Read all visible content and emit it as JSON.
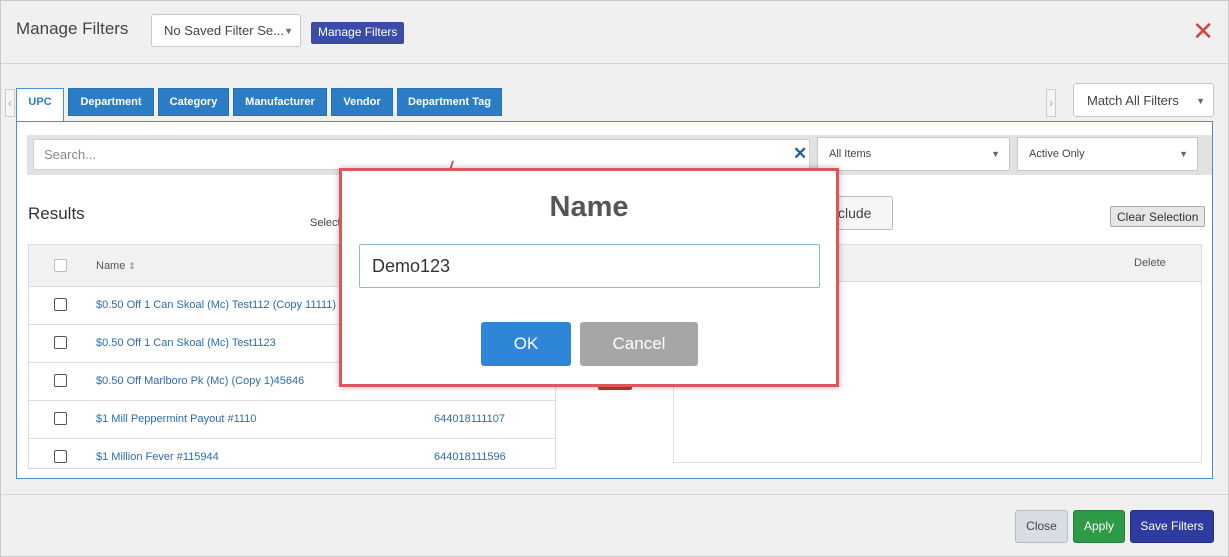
{
  "header": {
    "title": "Manage Filters",
    "saved_filter": "No Saved Filter Se...",
    "manage_button": "Manage Filters"
  },
  "tabs": [
    "UPC",
    "Department",
    "Category",
    "Manufacturer",
    "Vendor",
    "Department Tag"
  ],
  "match_select": "Match All Filters",
  "search": {
    "placeholder": "Search...",
    "items_select": "All Items",
    "status_select": "Active Only"
  },
  "results": {
    "title": "Results",
    "select_text": "Select",
    "col_name": "Name",
    "rows": [
      {
        "name": "$0.50 Off 1 Can Skoal (Mc) Test112 (Copy 11111)",
        "code": ""
      },
      {
        "name": "$0.50 Off 1 Can Skoal (Mc) Test1123",
        "code": ""
      },
      {
        "name": "$0.50 Off Marlboro Pk (Mc) (Copy 1)45646",
        "code": ""
      },
      {
        "name": "$1 Mill Peppermint Payout #1110",
        "code": "644018111107"
      },
      {
        "name": "$1 Million Fever #115944",
        "code": "644018111596"
      }
    ]
  },
  "selection": {
    "include_partial": "clude",
    "clear_button": "Clear Selection",
    "col_delete": "Delete"
  },
  "footer": {
    "close": "Close",
    "apply": "Apply",
    "save": "Save Filters"
  },
  "modal": {
    "title": "Name",
    "input_value": "Demo123",
    "ok": "OK",
    "cancel": "Cancel"
  },
  "colors": {
    "primary_blue": "#2b7ec6",
    "apply_green": "#2e9a45",
    "save_navy": "#2d3c9e",
    "modal_border": "#e0555a",
    "close_red": "#d0453c"
  }
}
